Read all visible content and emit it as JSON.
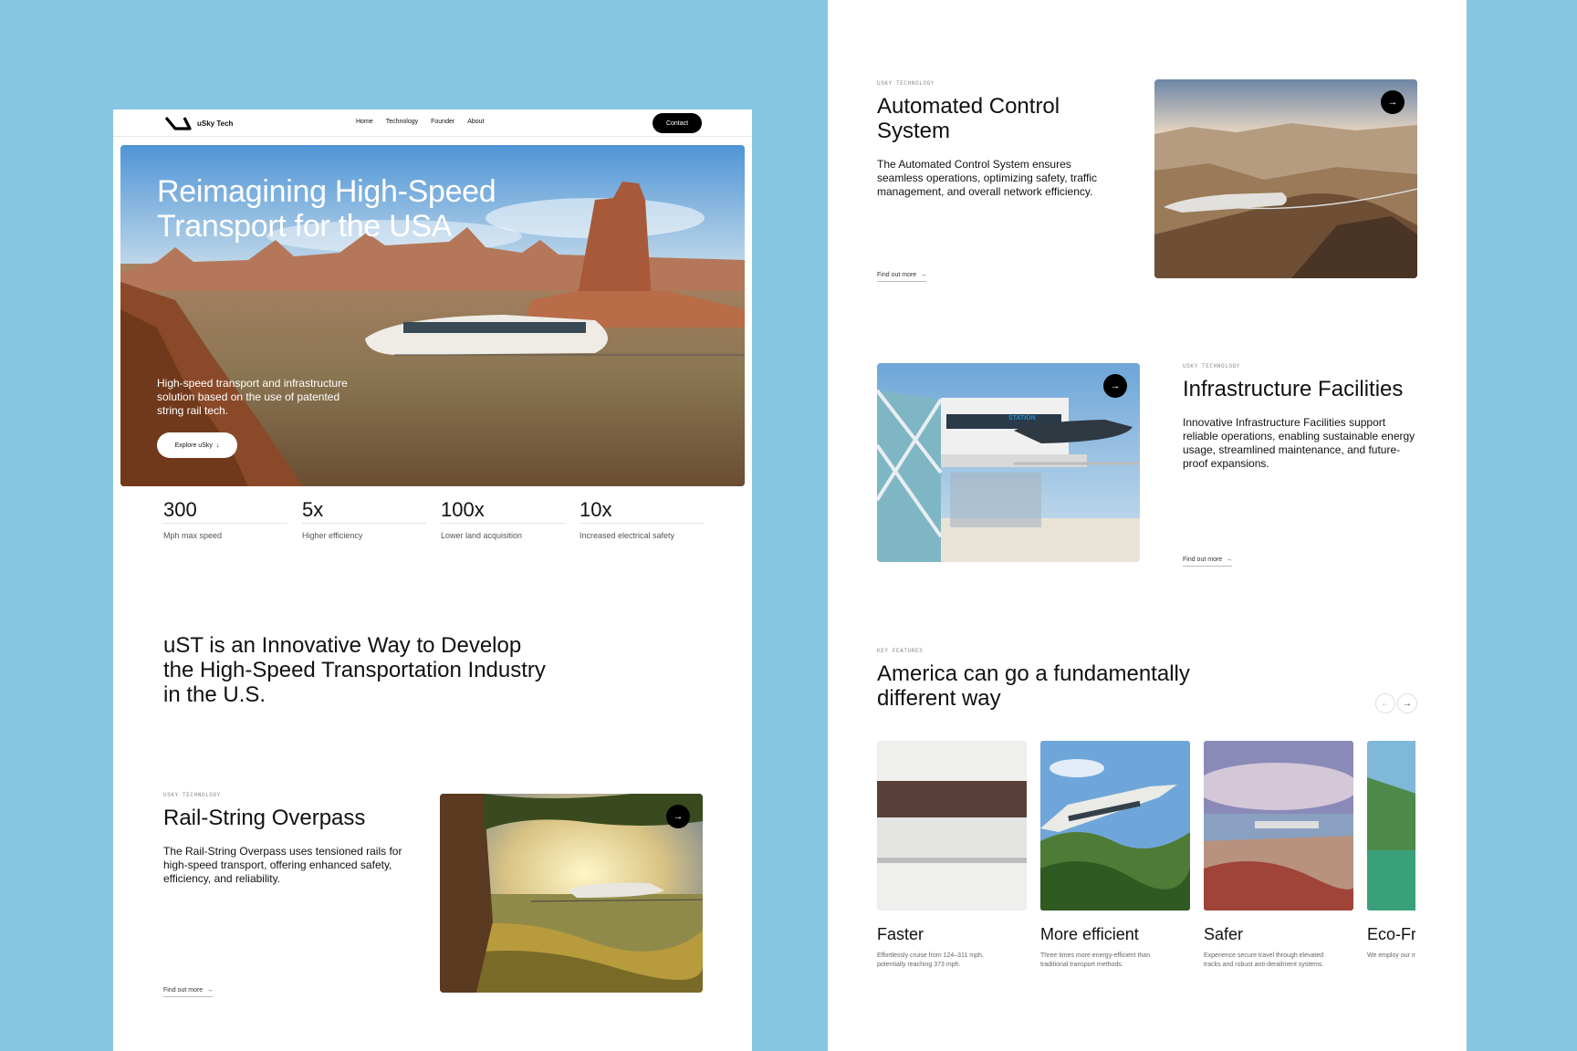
{
  "nav": {
    "brand": "uSky Tech",
    "links": [
      "Home",
      "Technology",
      "Founder",
      "About"
    ],
    "contact": "Contact"
  },
  "hero": {
    "title_line1": "Reimagining High-Speed",
    "title_line2": "Transport for the USA",
    "subtitle": "High-speed transport and infrastructure solution based on the use of patented string rail tech.",
    "cta": "Explore uSky"
  },
  "stats": [
    {
      "value": "300",
      "label": "Mph max speed"
    },
    {
      "value": "5x",
      "label": "Higher efficiency"
    },
    {
      "value": "100x",
      "label": "Lower land acquisition"
    },
    {
      "value": "10x",
      "label": "Increased electrical safety"
    }
  ],
  "mission": "uST is an Innovative Way to Develop the High-Speed Transportation Industry in the U.S.",
  "features": {
    "rail_string": {
      "eyebrow": "USKY TECHNOLOGY",
      "title": "Rail-String Overpass",
      "desc": "The Rail-String Overpass uses tensioned rails for high-speed transport, offering enhanced safety, efficiency, and reliability.",
      "link": "Find out more"
    },
    "automated": {
      "eyebrow": "USKY TECHNOLOGY",
      "title": "Automated Control System",
      "desc": "The Automated Control System ensures seamless operations, optimizing safety, traffic management, and overall network efficiency.",
      "link": "Find out more"
    },
    "infrastructure": {
      "eyebrow": "USKY TECHNOLOGY",
      "title": "Infrastructure Facilities",
      "desc": "Innovative Infrastructure Facilities support reliable operations, enabling sustainable energy usage, streamlined maintenance, and future-proof expansions.",
      "link": "Find out more",
      "station_sign": "STATION"
    }
  },
  "key_features": {
    "eyebrow": "KEY FEATURES",
    "title": "America can go a fundamentally different way",
    "cards": [
      {
        "title": "Faster",
        "desc": "Effortlessly cruise from 124–311 mph, potentially reaching 373 mph."
      },
      {
        "title": "More efficient",
        "desc": "Three times more energy-efficient than traditional transport methods."
      },
      {
        "title": "Safer",
        "desc": "Experience secure travel through elevated tracks and robust anti-derailment systems."
      },
      {
        "title": "Eco-Friendly",
        "desc": "We employ our minimal environmental footprint."
      }
    ]
  }
}
